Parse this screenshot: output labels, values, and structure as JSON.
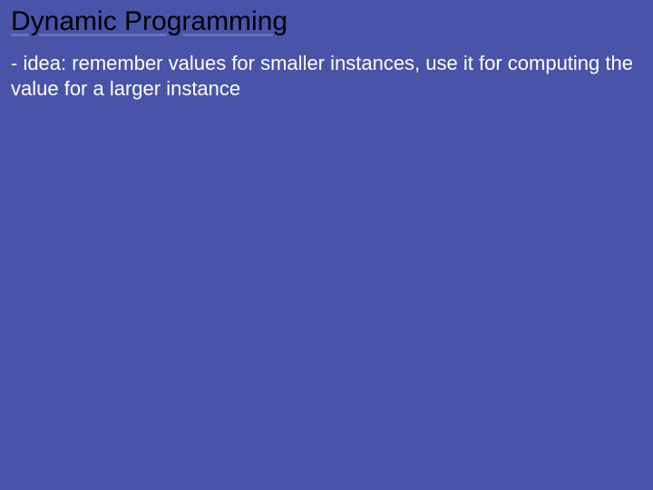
{
  "slide": {
    "title": "Dynamic Programming",
    "body": "- idea: remember values for smaller instances, use it for computing the value for a larger instance"
  }
}
